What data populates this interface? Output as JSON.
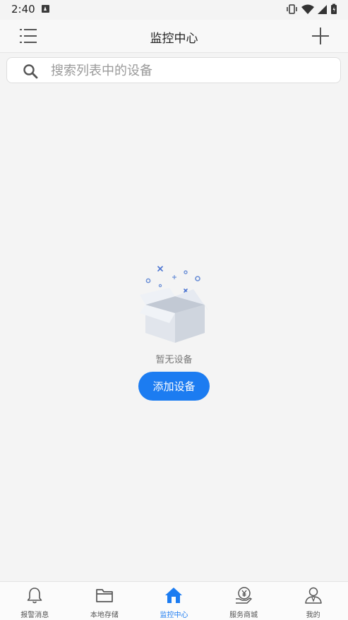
{
  "status_bar": {
    "time": "2:40"
  },
  "header": {
    "title": "监控中心"
  },
  "search": {
    "placeholder": "搜索列表中的设备"
  },
  "empty_state": {
    "message": "暂无设备",
    "button_label": "添加设备"
  },
  "bottom_nav": {
    "items": [
      {
        "label": "报警消息",
        "icon": "bell-icon"
      },
      {
        "label": "本地存储",
        "icon": "folder-icon"
      },
      {
        "label": "监控中心",
        "icon": "home-icon",
        "active": true
      },
      {
        "label": "服务商城",
        "icon": "yen-hand-icon"
      },
      {
        "label": "我的",
        "icon": "user-icon"
      }
    ]
  },
  "colors": {
    "accent": "#1c7cf1",
    "background": "#f4f4f4"
  }
}
